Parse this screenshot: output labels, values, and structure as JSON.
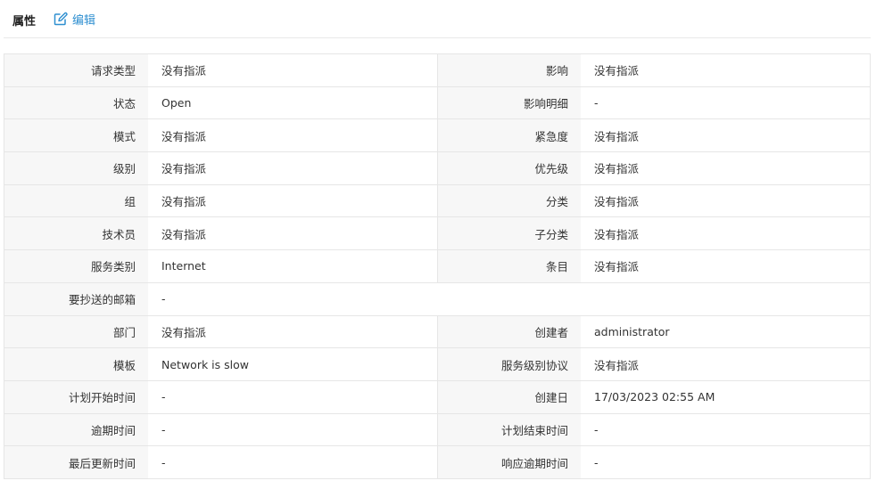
{
  "header": {
    "title": "属性",
    "edit_label": "编辑"
  },
  "rows": [
    {
      "l1": "请求类型",
      "v1": "没有指派",
      "l2": "影响",
      "v2": "没有指派"
    },
    {
      "l1": "状态",
      "v1": "Open",
      "l2": "影响明细",
      "v2": "-"
    },
    {
      "l1": "模式",
      "v1": "没有指派",
      "l2": "紧急度",
      "v2": "没有指派"
    },
    {
      "l1": "级别",
      "v1": "没有指派",
      "l2": "优先级",
      "v2": "没有指派"
    },
    {
      "l1": "组",
      "v1": "没有指派",
      "l2": "分类",
      "v2": "没有指派"
    },
    {
      "l1": "技术员",
      "v1": "没有指派",
      "l2": "子分类",
      "v2": "没有指派"
    },
    {
      "l1": "服务类别",
      "v1": "Internet",
      "l2": "条目",
      "v2": "没有指派"
    },
    {
      "l1": "要抄送的邮箱",
      "v1": "-"
    },
    {
      "l1": "部门",
      "v1": "没有指派",
      "l2": "创建者",
      "v2": "administrator"
    },
    {
      "l1": "模板",
      "v1": "Network is slow",
      "l2": "服务级别协议",
      "v2": "没有指派"
    },
    {
      "l1": "计划开始时间",
      "v1": "-",
      "l2": "创建日",
      "v2": "17/03/2023 02:55 AM"
    },
    {
      "l1": "逾期时间",
      "v1": "-",
      "l2": "计划结束时间",
      "v2": "-"
    },
    {
      "l1": "最后更新时间",
      "v1": "-",
      "l2": "响应逾期时间",
      "v2": "-"
    }
  ]
}
